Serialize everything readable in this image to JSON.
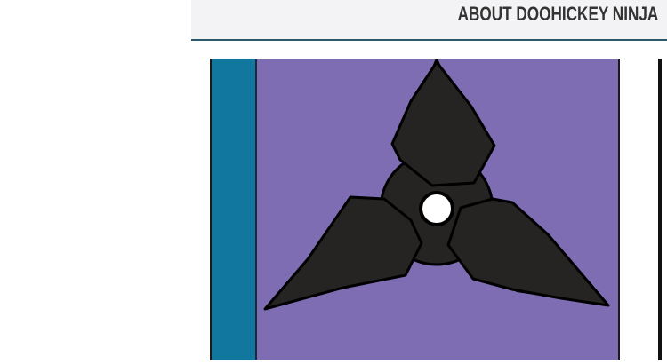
{
  "header": {
    "title": "ABOUT DOOHICKEY NINJA"
  },
  "hero_image": {
    "icon": "shuriken-icon",
    "background_color": "#7f6db3",
    "stripe_color": "#12779f",
    "blade_color": "#252422",
    "edge_color": "#c9c3bc"
  }
}
